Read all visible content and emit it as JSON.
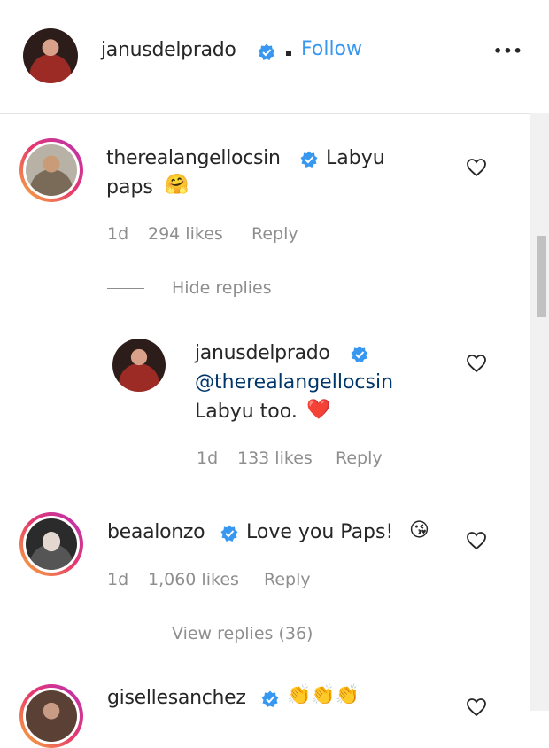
{
  "header": {
    "username": "janusdelprado",
    "separator": "•",
    "follow_label": "Follow",
    "more_label": "•••"
  },
  "comments": [
    {
      "username": "therealangellocsin",
      "text_line1": "Labyu",
      "text_line2": "paps",
      "emoji": "🤗",
      "time": "1d",
      "likes": "294 likes",
      "reply_label": "Reply",
      "replies_toggle": "Hide replies",
      "replies": [
        {
          "username": "janusdelprado",
          "mention": "@therealangellocsin",
          "text": "Labyu too.",
          "emoji": "❤️",
          "time": "1d",
          "likes": "133 likes",
          "reply_label": "Reply"
        }
      ]
    },
    {
      "username": "beaalonzo",
      "text": "Love you Paps!",
      "emoji": "😘",
      "time": "1d",
      "likes": "1,060 likes",
      "reply_label": "Reply",
      "replies_toggle": "View replies (36)"
    },
    {
      "username": "gisellesanchez",
      "emoji": "👏👏👏"
    }
  ],
  "colors": {
    "verified": "#3897f0",
    "follow": "#3897f0",
    "mention": "#00376b",
    "meta": "#8e8e8e"
  },
  "icons": [
    "verified-badge-icon",
    "heart-icon",
    "more-options-icon"
  ]
}
